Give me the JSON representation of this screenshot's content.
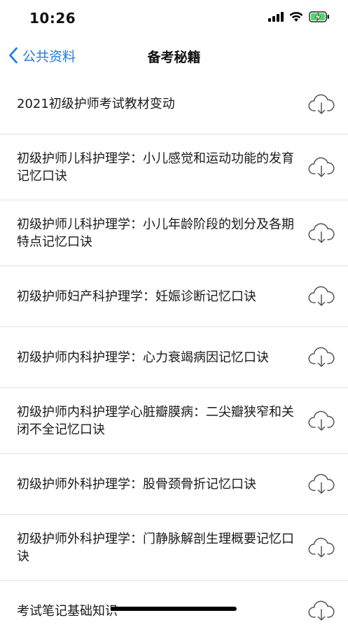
{
  "status_bar": {
    "time": "10:26",
    "battery_icon": "battery-charging-icon",
    "wifi_icon": "wifi-icon",
    "signal_icon": "cellular-signal-icon"
  },
  "nav": {
    "back_label": "公共资料",
    "title": "备考秘籍",
    "back_icon": "chevron-left-icon"
  },
  "colors": {
    "accent": "#1f7ae0",
    "battery": "#4cd964",
    "divider": "#e3e3e3"
  },
  "items": [
    {
      "label": "2021初级护师考试教材变动",
      "icon": "cloud-download-icon"
    },
    {
      "label": "初级护师儿科护理学：小儿感觉和运动功能的发育记忆口诀",
      "icon": "cloud-download-icon"
    },
    {
      "label": "初级护师儿科护理学：小儿年龄阶段的划分及各期特点记忆口诀",
      "icon": "cloud-download-icon"
    },
    {
      "label": "初级护师妇产科护理学：妊娠诊断记忆口诀",
      "icon": "cloud-download-icon"
    },
    {
      "label": "初级护师内科护理学：心力衰竭病因记忆口诀",
      "icon": "cloud-download-icon"
    },
    {
      "label": "初级护师内科护理学心脏瓣膜病：二尖瓣狭窄和关闭不全记忆口诀",
      "icon": "cloud-download-icon"
    },
    {
      "label": "初级护师外科护理学：股骨颈骨折记忆口诀",
      "icon": "cloud-download-icon"
    },
    {
      "label": "初级护师外科护理学：门静脉解剖生理概要记忆口诀",
      "icon": "cloud-download-icon"
    },
    {
      "label": "考试笔记基础知识",
      "icon": "cloud-download-icon"
    }
  ]
}
